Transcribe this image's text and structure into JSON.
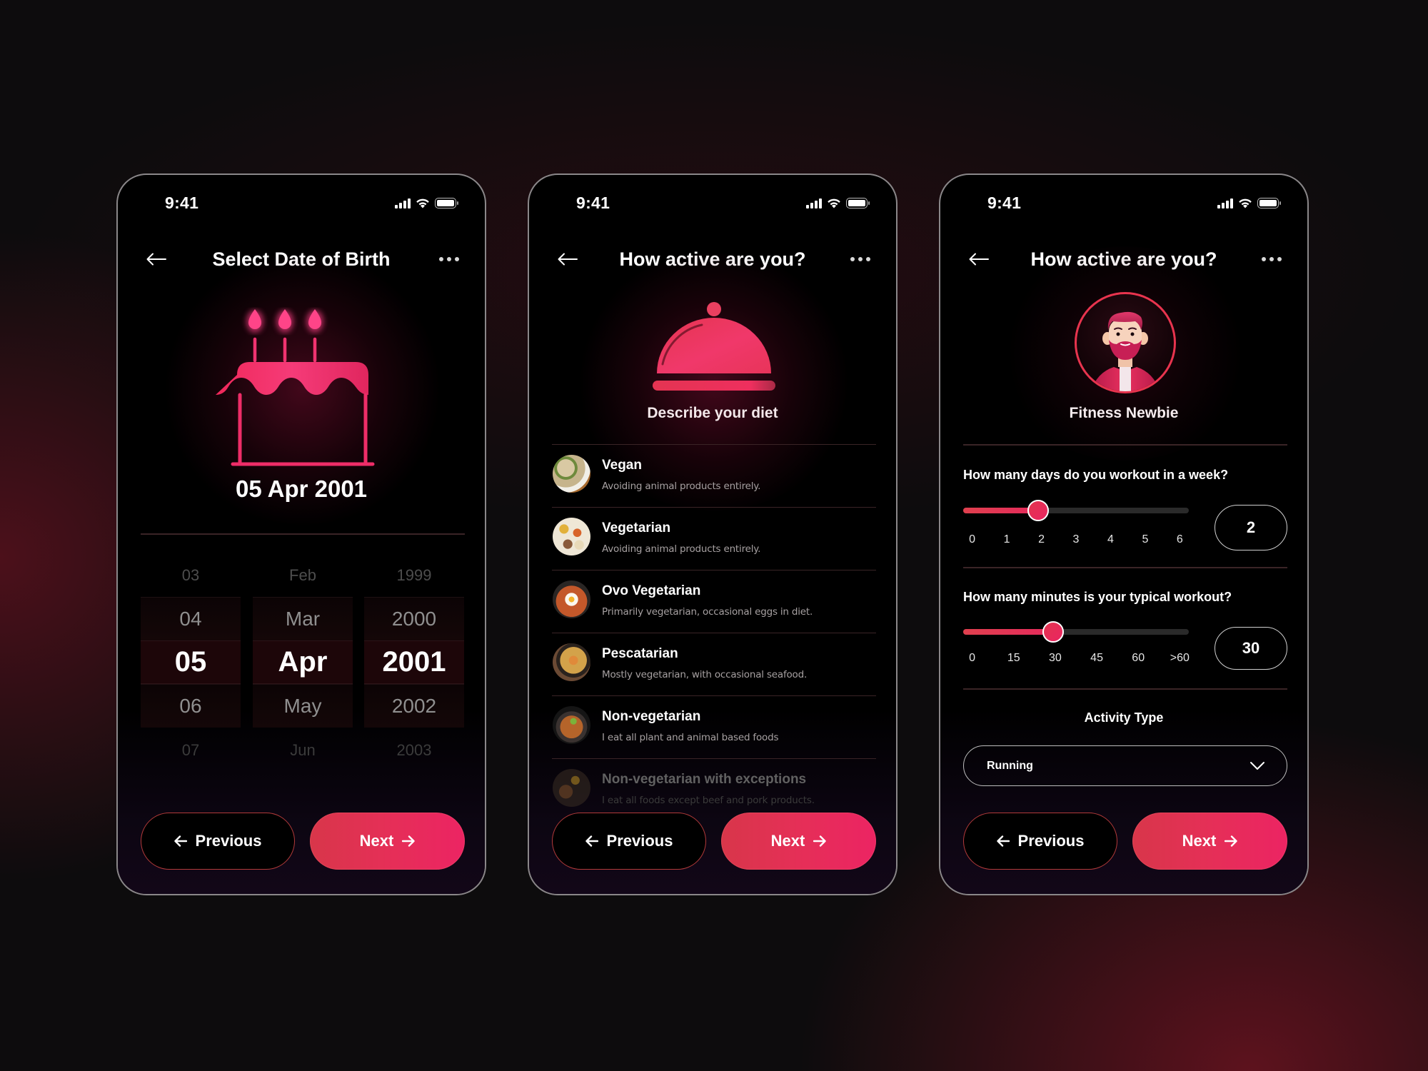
{
  "colors": {
    "accent": "#e8344e",
    "accent_gradient_start": "#d8364a",
    "accent_gradient_end": "#ec2463",
    "background": "#0d0c0d",
    "screen": "#000000"
  },
  "screens": [
    {
      "status": {
        "time": "9:41"
      },
      "header": {
        "title": "Select Date of Birth",
        "back_icon": "arrow-left-icon",
        "more_icon": "more-horizontal-icon"
      },
      "hero_icon": "birthday-cake-icon",
      "selected_date": "05 Apr 2001",
      "picker": {
        "day": {
          "items": [
            "03",
            "04",
            "05",
            "06",
            "07"
          ],
          "selected": "05"
        },
        "month": {
          "items": [
            "Feb",
            "Mar",
            "Apr",
            "May",
            "Jun"
          ],
          "selected": "Apr"
        },
        "year": {
          "items": [
            "1999",
            "2000",
            "2001",
            "2002",
            "2003"
          ],
          "selected": "2001"
        }
      },
      "buttons": {
        "previous": "Previous",
        "next": "Next"
      }
    },
    {
      "status": {
        "time": "9:41"
      },
      "header": {
        "title": "How active are you?",
        "back_icon": "arrow-left-icon",
        "more_icon": "more-horizontal-icon"
      },
      "hero_icon": "food-cloche-icon",
      "caption": "Describe your diet",
      "diet_options": [
        {
          "name": "Vegan",
          "description": "Avoiding animal products entirely.",
          "image": "vegan-dish-photo"
        },
        {
          "name": "Vegetarian",
          "description": "Avoiding animal products entirely.",
          "image": "vegetarian-thali-photo"
        },
        {
          "name": "Ovo Vegetarian",
          "description": "Primarily vegetarian, occasional eggs in diet.",
          "image": "egg-vegetable-pan-photo"
        },
        {
          "name": "Pescatarian",
          "description": "Mostly vegetarian, with occasional seafood.",
          "image": "shrimp-paella-photo"
        },
        {
          "name": "Non-vegetarian",
          "description": "I eat all plant and animal based foods",
          "image": "chicken-curry-photo"
        },
        {
          "name": "Non-vegetarian with exceptions",
          "description": "I eat all foods except beef and pork products.",
          "image": "mixed-platter-photo"
        }
      ],
      "buttons": {
        "previous": "Previous",
        "next": "Next"
      }
    },
    {
      "status": {
        "time": "9:41"
      },
      "header": {
        "title": "How active are you?",
        "back_icon": "arrow-left-icon",
        "more_icon": "more-horizontal-icon"
      },
      "avatar": "bearded-man-avatar",
      "persona": "Fitness Newbie",
      "days_question": {
        "label": "How many days do you workout in a week?",
        "ticks": [
          "0",
          "1",
          "2",
          "3",
          "4",
          "5",
          "6"
        ],
        "value": "2",
        "fraction": 0.3333
      },
      "minutes_question": {
        "label": "How many minutes is your typical workout?",
        "ticks": [
          "0",
          "15",
          "30",
          "45",
          "60",
          ">60"
        ],
        "value": "30",
        "fraction": 0.4
      },
      "activity": {
        "label": "Activity Type",
        "selected": "Running"
      },
      "buttons": {
        "previous": "Previous",
        "next": "Next"
      }
    }
  ]
}
